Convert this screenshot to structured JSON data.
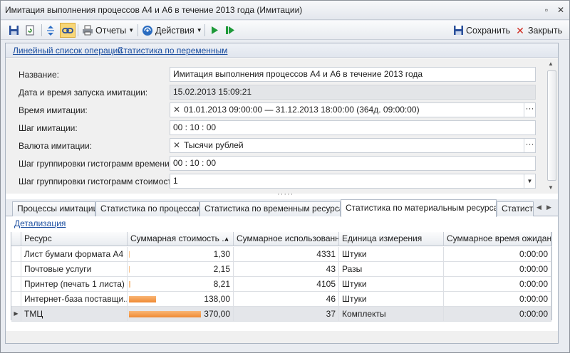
{
  "window": {
    "title": "Имитация выполнения процессов А4 и А6 в течение 2013 года (Имитации)",
    "restore_glyph": "▫",
    "close_glyph": "✕"
  },
  "toolbar": {
    "reports_label": "Отчеты",
    "actions_label": "Действия",
    "save_label": "Сохранить",
    "close_label": "Закрыть"
  },
  "links": {
    "op_list": "Линейный список операций",
    "var_stats": "Статистика по переменным"
  },
  "form": {
    "name_label": "Название:",
    "name_value": "Имитация выполнения процессов А4 и А6 в течение 2013 года",
    "start_label": "Дата и время запуска имитации:",
    "start_value": "15.02.2013 15:09:21",
    "time_label": "Время имитации:",
    "time_value": "01.01.2013 09:00:00 — 31.12.2013 18:00:00 (364д. 09:00:00)",
    "step_label": "Шаг имитации:",
    "step_value": "00 : 10 : 00",
    "currency_label": "Валюта имитации:",
    "currency_value": "Тысячи рублей",
    "time_hist_label": "Шаг группировки гистограмм времени:",
    "time_hist_value": "00 : 10 : 00",
    "cost_hist_label": "Шаг группировки гистограмм стоимости:",
    "cost_hist_value": "1"
  },
  "tabs": [
    {
      "label": "Процессы имитации"
    },
    {
      "label": "Статистика по процессам"
    },
    {
      "label": "Статистика по временным ресурсам"
    },
    {
      "label": "Статистика по материальным ресурсам"
    },
    {
      "label": "Статистика"
    }
  ],
  "detail_link": "Детализация",
  "table": {
    "headers": [
      "Ресурс",
      "Суммарная стоимость ...",
      "Суммарное использованн...",
      "Единица измерения",
      "Суммарное время ожидания"
    ],
    "rows": [
      {
        "resource": "Лист бумаги формата А4",
        "cost": "1,30",
        "cost_fraction": 0.0035,
        "usage": "4331",
        "unit": "Штуки",
        "wait": "0:00:00"
      },
      {
        "resource": "Почтовые услуги",
        "cost": "2,15",
        "cost_fraction": 0.0058,
        "usage": "43",
        "unit": "Разы",
        "wait": "0:00:00"
      },
      {
        "resource": "Принтер (печать 1 листа)",
        "cost": "8,21",
        "cost_fraction": 0.0222,
        "usage": "4105",
        "unit": "Штуки",
        "wait": "0:00:00"
      },
      {
        "resource": "Интернет-база поставщи...",
        "cost": "138,00",
        "cost_fraction": 0.373,
        "usage": "46",
        "unit": "Штуки",
        "wait": "0:00:00"
      },
      {
        "resource": "ТМЦ",
        "cost": "370,00",
        "cost_fraction": 1.0,
        "usage": "37",
        "unit": "Комплекты",
        "wait": "0:00:00"
      }
    ]
  },
  "colors": {
    "accent": "#1c4fa0",
    "bar": "#ef8a33"
  }
}
